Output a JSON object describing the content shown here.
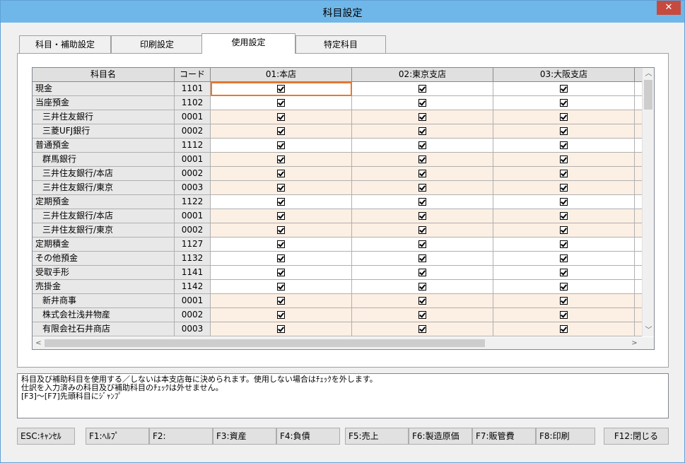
{
  "window": {
    "title": "科目設定",
    "close_symbol": "✕"
  },
  "tabs": [
    {
      "label": "科目・補助設定",
      "active": false
    },
    {
      "label": "印刷設定",
      "active": false
    },
    {
      "label": "使用設定",
      "active": true
    },
    {
      "label": "特定科目",
      "active": false
    }
  ],
  "grid": {
    "headers": {
      "name": "科目名",
      "code": "コード",
      "branches": [
        "01:本店",
        "02:東京支店",
        "03:大阪支店"
      ]
    },
    "rows": [
      {
        "name": "現金",
        "code": "1101",
        "sub": false
      },
      {
        "name": "当座預金",
        "code": "1102",
        "sub": false
      },
      {
        "name": "三井住友銀行",
        "code": "0001",
        "sub": true
      },
      {
        "name": "三菱UFJ銀行",
        "code": "0002",
        "sub": true
      },
      {
        "name": "普通預金",
        "code": "1112",
        "sub": false
      },
      {
        "name": "群馬銀行",
        "code": "0001",
        "sub": true
      },
      {
        "name": "三井住友銀行/本店",
        "code": "0002",
        "sub": true
      },
      {
        "name": "三井住友銀行/東京",
        "code": "0003",
        "sub": true
      },
      {
        "name": "定期預金",
        "code": "1122",
        "sub": false
      },
      {
        "name": "三井住友銀行/本店",
        "code": "0001",
        "sub": true
      },
      {
        "name": "三井住友銀行/東京",
        "code": "0002",
        "sub": true
      },
      {
        "name": "定期積金",
        "code": "1127",
        "sub": false
      },
      {
        "name": "その他預金",
        "code": "1132",
        "sub": false
      },
      {
        "name": "受取手形",
        "code": "1141",
        "sub": false
      },
      {
        "name": "売掛金",
        "code": "1142",
        "sub": false
      },
      {
        "name": "新井商事",
        "code": "0001",
        "sub": true
      },
      {
        "name": "株式会社浅井物産",
        "code": "0002",
        "sub": true
      },
      {
        "name": "有限会社石井商店",
        "code": "0003",
        "sub": true
      }
    ],
    "all_checked": true
  },
  "message": {
    "lines": [
      "科目及び補助科目を使用する／しないは本支店毎に決められます。使用しない場合はﾁｪｯｸを外します。",
      "仕訳を入力済みの科目及び補助科目のﾁｪｯｸは外せません。",
      "[F3]～[F7]先頭科目にｼﾞｬﾝﾌﾟ"
    ]
  },
  "fkeys": [
    {
      "label": "ESC:ｷｬﾝｾﾙ"
    },
    {
      "label": "F1:ﾍﾙﾌﾟ"
    },
    {
      "label": "F2:"
    },
    {
      "label": "F3:資産"
    },
    {
      "label": "F4:負債"
    },
    {
      "label": "F5:売上"
    },
    {
      "label": "F6:製造原価"
    },
    {
      "label": "F7:販管費"
    },
    {
      "label": "F8:印刷"
    },
    {
      "label": "F12:閉じる"
    }
  ]
}
